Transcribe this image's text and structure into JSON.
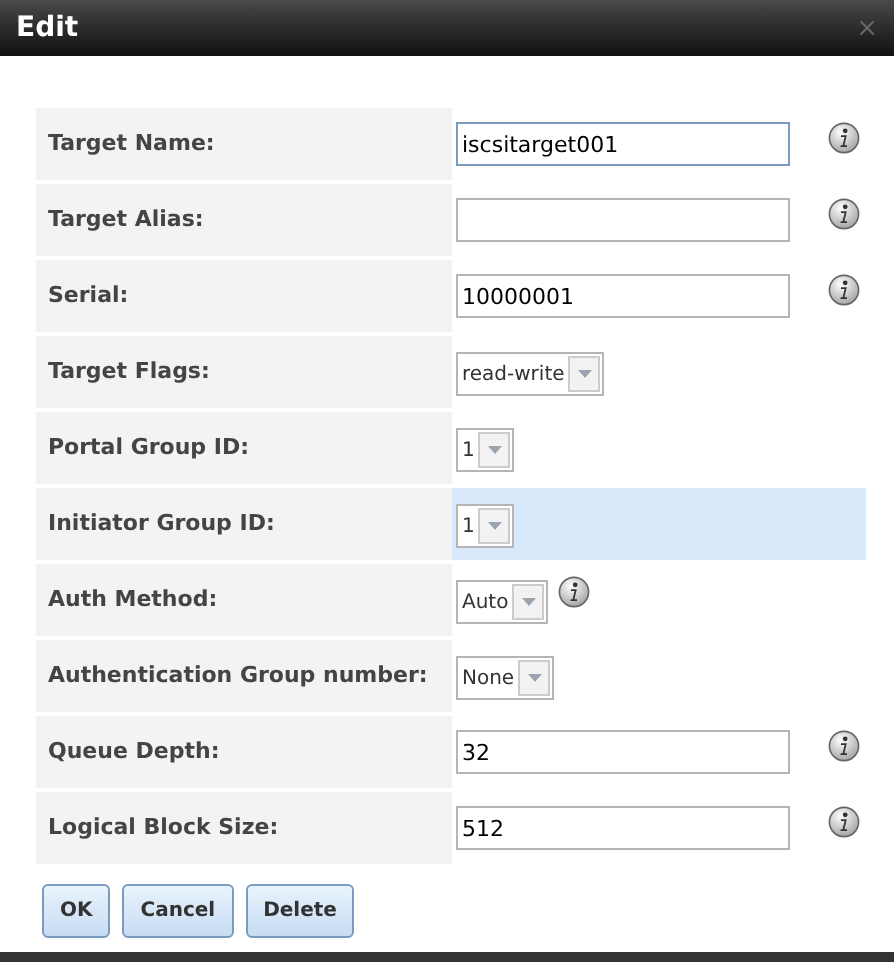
{
  "window": {
    "title": "Edit",
    "close": "×"
  },
  "rows": [
    {
      "label": "Target Name:",
      "kind": "text",
      "value": "iscsitarget001",
      "focused": true,
      "info": true,
      "highlighted": false
    },
    {
      "label": "Target Alias:",
      "kind": "text",
      "value": "",
      "focused": false,
      "info": true,
      "highlighted": false
    },
    {
      "label": "Serial:",
      "kind": "text",
      "value": "10000001",
      "focused": false,
      "info": true,
      "highlighted": false
    },
    {
      "label": "Target Flags:",
      "kind": "select",
      "value": "read-write",
      "info": false,
      "highlighted": false
    },
    {
      "label": "Portal Group ID:",
      "kind": "select",
      "value": "1",
      "info": false,
      "highlighted": false
    },
    {
      "label": "Initiator Group ID:",
      "kind": "select",
      "value": "1",
      "info": false,
      "highlighted": true
    },
    {
      "label": "Auth Method:",
      "kind": "select",
      "value": "Auto",
      "info": true,
      "highlighted": false
    },
    {
      "label": "Authentication Group number:",
      "kind": "select",
      "value": "None",
      "info": false,
      "highlighted": false
    },
    {
      "label": "Queue Depth:",
      "kind": "text",
      "value": "32",
      "focused": false,
      "info": true,
      "highlighted": false
    },
    {
      "label": "Logical Block Size:",
      "kind": "text",
      "value": "512",
      "focused": false,
      "info": true,
      "highlighted": false
    }
  ],
  "buttons": [
    "OK",
    "Cancel",
    "Delete"
  ]
}
